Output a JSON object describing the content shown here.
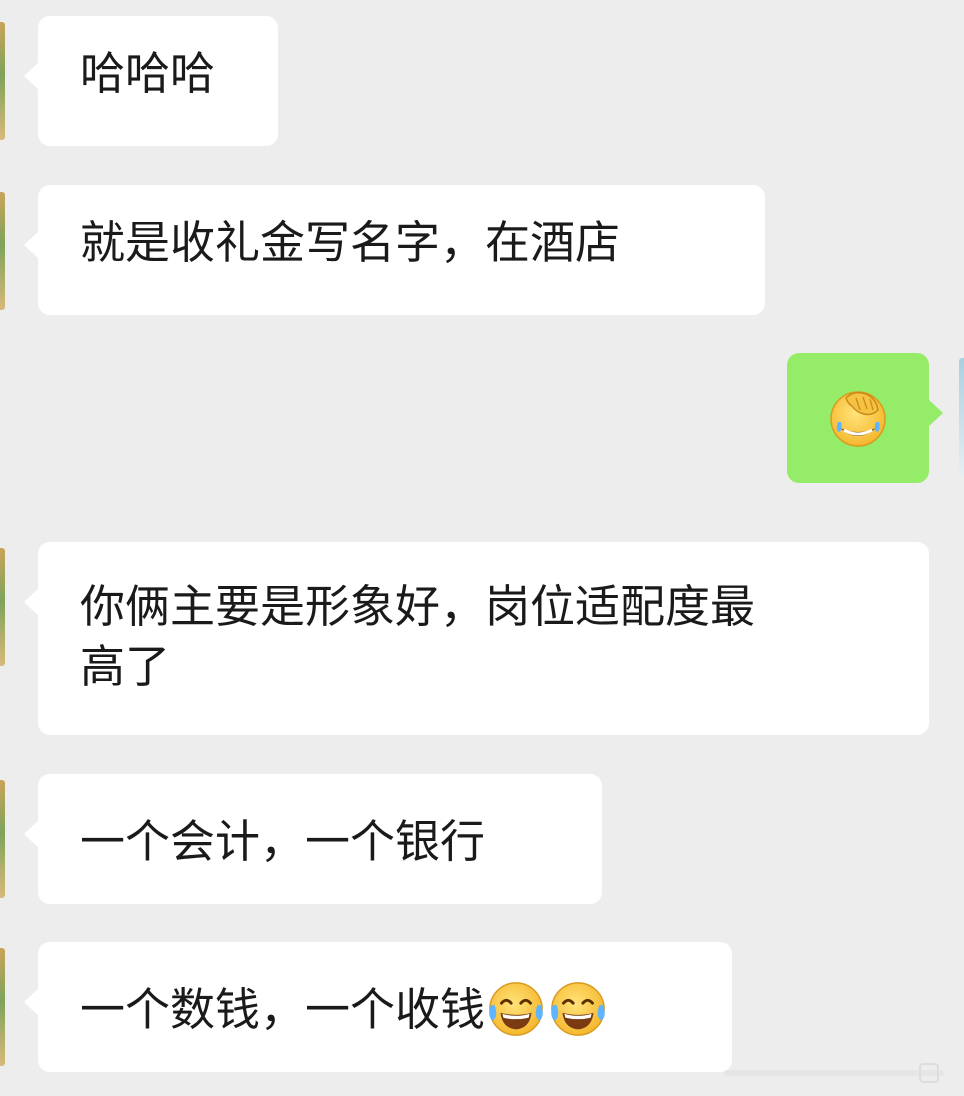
{
  "chat": {
    "messages": [
      {
        "sender": "other",
        "text": "哈哈哈"
      },
      {
        "sender": "other",
        "text": "就是收礼金写名字，在酒店"
      },
      {
        "sender": "self",
        "emoji": "face-palm-laughing-emoji"
      },
      {
        "sender": "other",
        "text_line1": "你俩主要是形象好，岗位适配度最",
        "text_line2": "高了"
      },
      {
        "sender": "other",
        "text": "一个会计，一个银行"
      },
      {
        "sender": "other",
        "text": "一个数钱，一个收钱",
        "emojis": [
          "tears-of-joy-emoji",
          "tears-of-joy-emoji"
        ]
      }
    ]
  },
  "colors": {
    "background": "#ededed",
    "incoming_bubble": "#ffffff",
    "outgoing_bubble": "#95ec69"
  }
}
